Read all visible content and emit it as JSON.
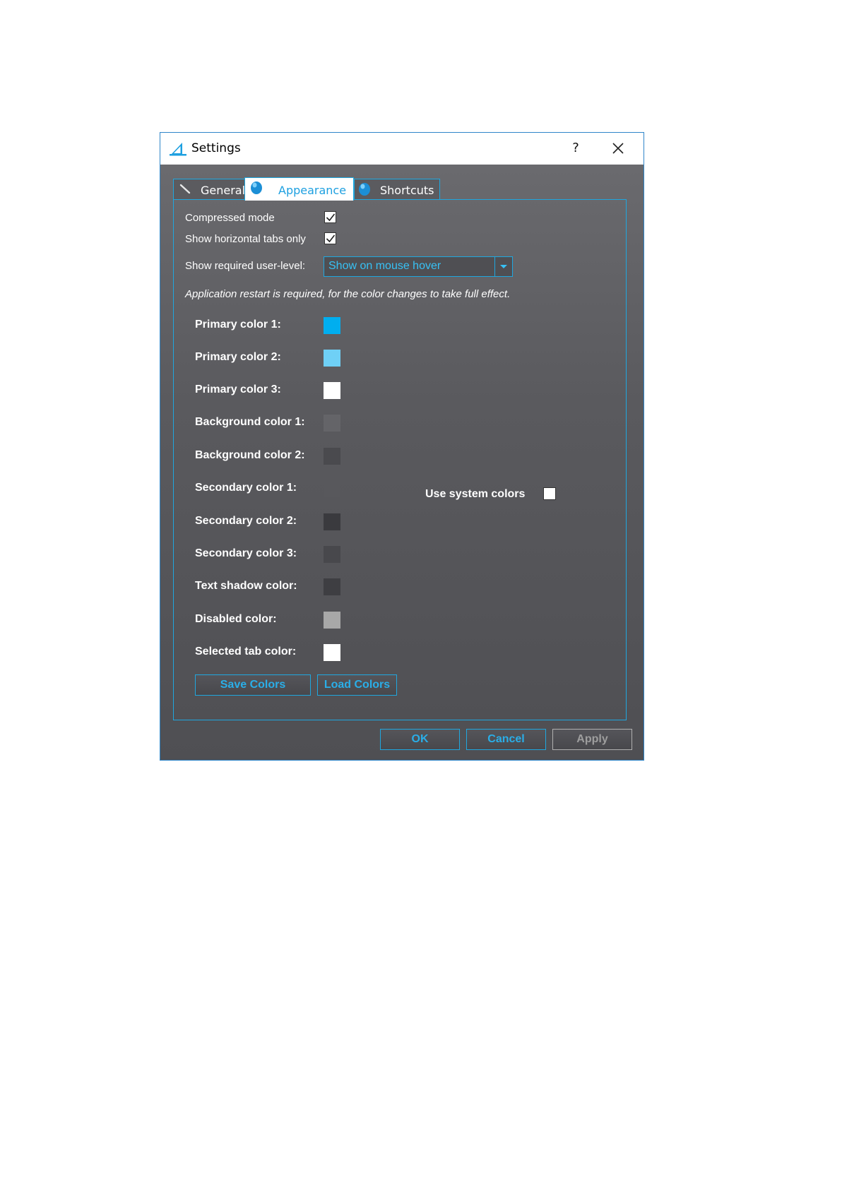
{
  "window": {
    "title": "Settings",
    "help_label": "?"
  },
  "tabs": [
    {
      "label": "General",
      "icon": "wrench-icon"
    },
    {
      "label": "Appearance",
      "icon": "globe-icon"
    },
    {
      "label": "Shortcuts",
      "icon": "globe-icon"
    }
  ],
  "options": {
    "compressed_mode": {
      "label": "Compressed mode",
      "checked": true
    },
    "horizontal_tabs": {
      "label": "Show horizontal tabs only",
      "checked": true
    },
    "user_level": {
      "label": "Show required user-level:",
      "value": "Show on mouse hover"
    }
  },
  "note": "Application restart is required, for the color changes to take full effect.",
  "colors": [
    {
      "label": "Primary color 1:",
      "hex": "#00aeef"
    },
    {
      "label": "Primary color 2:",
      "hex": "#6fd0f6"
    },
    {
      "label": "Primary color 3:",
      "hex": "#ffffff"
    },
    {
      "label": "Background color 1:",
      "hex": "#646468"
    },
    {
      "label": "Background color 2:",
      "hex": "#4a4a4e"
    },
    {
      "label": "Secondary color 1:",
      "hex": "#58585c"
    },
    {
      "label": "Secondary color 2:",
      "hex": "#3a3a3e"
    },
    {
      "label": "Secondary color 3:",
      "hex": "#48484c"
    },
    {
      "label": "Text shadow color:",
      "hex": "#3e3e42"
    },
    {
      "label": "Disabled color:",
      "hex": "#a8a8a8"
    },
    {
      "label": "Selected tab color:",
      "hex": "#ffffff"
    }
  ],
  "system_colors": {
    "label": "Use system colors",
    "checked": false
  },
  "buttons": {
    "save_colors": "Save Colors",
    "load_colors": "Load Colors",
    "ok": "OK",
    "cancel": "Cancel",
    "apply": "Apply"
  },
  "theme": {
    "accent": "#1fa7df",
    "text_accent": "#37c1f5"
  }
}
